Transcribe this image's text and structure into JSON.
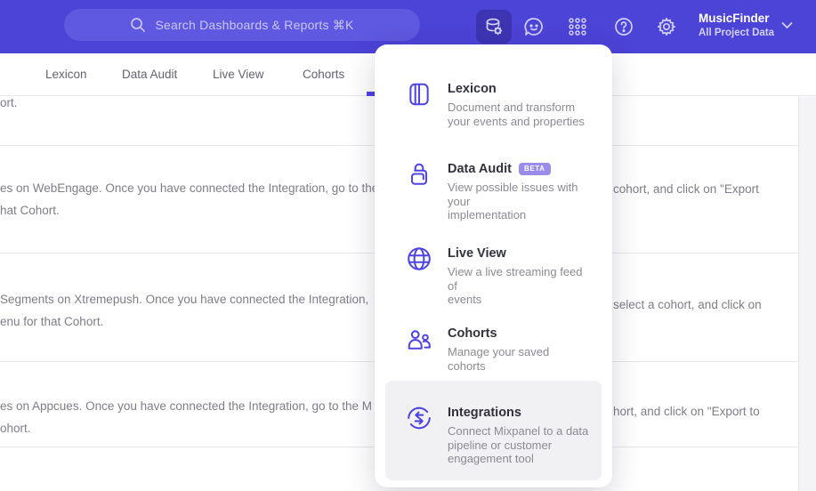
{
  "colors": {
    "accent": "#4f44e0",
    "header_bg": "#4c43d7",
    "active_tile_bg": "#3c34b2",
    "badge_bg": "#9a8ce8",
    "highlight_bg": "#f1f1f4"
  },
  "header": {
    "search_placeholder": "Search Dashboards & Reports ⌘K",
    "project_name": "MusicFinder",
    "project_scope": "All Project Data"
  },
  "tabs": {
    "lexicon": "Lexicon",
    "data_audit": "Data Audit",
    "live_view": "Live View",
    "cohorts": "Cohorts"
  },
  "menu": {
    "items": [
      {
        "title": "Lexicon",
        "description": "Document and transform\nyour events and properties"
      },
      {
        "title": "Data Audit",
        "badge": "BETA",
        "description": "View possible issues with your\nimplementation"
      },
      {
        "title": "Live View",
        "description": "View a live streaming feed of\nevents"
      },
      {
        "title": "Cohorts",
        "description": "Manage your saved cohorts"
      },
      {
        "title": "Integrations",
        "description": "Connect Mixpanel to a data\npipeline or customer\nengagement tool"
      }
    ]
  },
  "content": {
    "rows": [
      {
        "left_line1": "ort."
      },
      {
        "left_line1": "es on WebEngage. Once you have connected the Integration, go to the",
        "right_line1": "cohort, and click on \"Export",
        "left_line2": "hat Cohort."
      },
      {
        "left_line1": "Segments on Xtremepush. Once you have connected the Integration, ",
        "right_line1": "select a cohort, and click on",
        "left_line2": "enu for that Cohort."
      },
      {
        "left_line1": "es on Appcues. Once you have connected the Integration, go to the M",
        "right_line1": "hort, and click on \"Export to",
        "left_line2": "ohort."
      }
    ]
  }
}
